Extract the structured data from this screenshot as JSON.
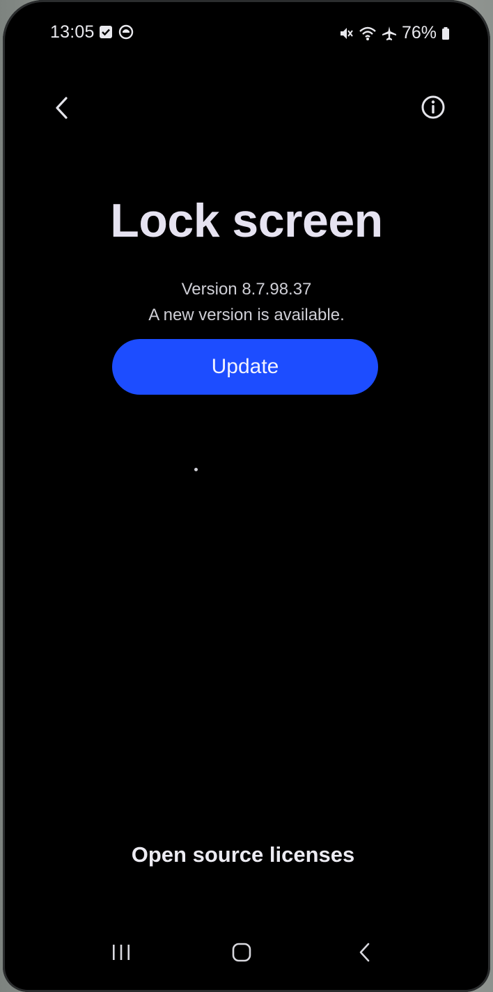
{
  "status_bar": {
    "time": "13:05",
    "battery": "76%",
    "left_icons": [
      "checkbox-notification-icon",
      "app-notification-icon"
    ],
    "right_icons": [
      "mute-icon",
      "wifi-icon",
      "airplane-icon",
      "battery-icon"
    ]
  },
  "top_bar": {
    "back_icon": "chevron-left-icon",
    "info_icon": "info-icon"
  },
  "app": {
    "title": "Lock screen",
    "version": "Version 8.7.98.37",
    "availability": "A new version is available.",
    "update_label": "Update",
    "accent_color": "#1d4dff"
  },
  "footer": {
    "oss_label": "Open source licenses"
  },
  "system_nav": {
    "icons": [
      "recents-icon",
      "home-icon",
      "back-icon"
    ]
  }
}
